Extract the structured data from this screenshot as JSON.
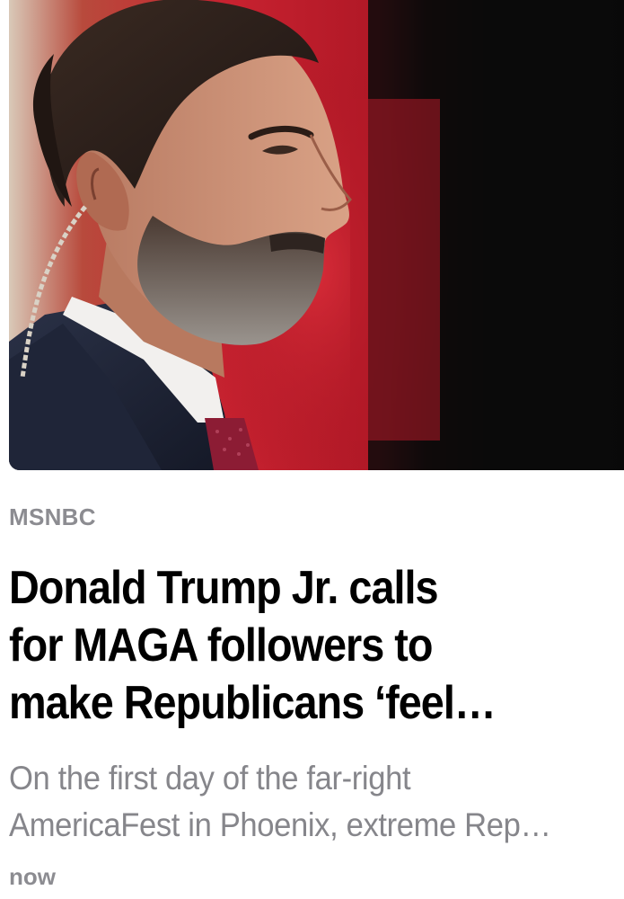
{
  "article": {
    "image": {
      "semantic": "news-photo",
      "background_colors": [
        "#c8202c",
        "#0b0b0c"
      ]
    },
    "source": "MSNBC",
    "headline_lines": [
      "Donald Trump Jr. calls",
      "for MAGA followers to",
      "make Republicans ‘feel…"
    ],
    "summary_lines": [
      "On the first day of the far-right",
      "AmericaFest in Phoenix, extreme Rep…"
    ],
    "timestamp": "now"
  },
  "colors": {
    "meta_text": "#8c8c91",
    "headline_text": "#000000",
    "summary_text": "#86868b"
  }
}
